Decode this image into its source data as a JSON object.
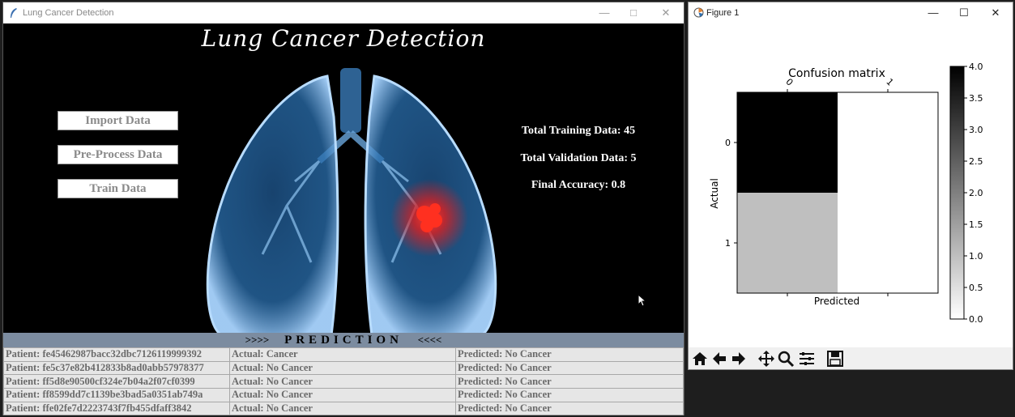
{
  "left_window": {
    "title": "Lung Cancer Detection",
    "controls": {
      "minimize": "—",
      "maximize": "□",
      "close": "✕"
    }
  },
  "app": {
    "heading": "Lung Cancer Detection",
    "buttons": {
      "import": "Import Data",
      "preprocess": "Pre-Process Data",
      "train": "Train Data"
    },
    "stats": {
      "training": "Total Training Data: 45",
      "validation": "Total Validation Data: 5",
      "accuracy": "Final Accuracy: 0.8"
    },
    "prediction": {
      "arrows_left": ">>>>",
      "label": "PREDICTION",
      "arrows_right": "<<<<",
      "rows": [
        {
          "patient": "Patient: fe45462987bacc32dbc7126119999392",
          "actual": "Actual: Cancer",
          "predicted": "Predicted: No Cancer"
        },
        {
          "patient": "Patient: fe5c37e82b412833b8ad0abb57978377",
          "actual": "Actual: No Cancer",
          "predicted": "Predicted: No Cancer"
        },
        {
          "patient": "Patient: ff5d8e90500cf324e7b04a2f07cf0399",
          "actual": "Actual: No Cancer",
          "predicted": "Predicted: No Cancer"
        },
        {
          "patient": "Patient: ff8599dd7c1139be3bad5a0351ab749a",
          "actual": "Actual: No Cancer",
          "predicted": "Predicted: No Cancer"
        },
        {
          "patient": "Patient: ffe02fe7d2223743f7fb455dfaff3842",
          "actual": "Actual: No Cancer",
          "predicted": "Predicted: No Cancer"
        }
      ]
    }
  },
  "right_window": {
    "title": "Figure 1",
    "controls": {
      "minimize": "—",
      "maximize": "☐",
      "close": "✕"
    },
    "toolbar": [
      "home-icon",
      "back-icon",
      "forward-icon",
      "pan-icon",
      "zoom-icon",
      "configure-icon",
      "save-icon"
    ]
  },
  "chart_data": {
    "type": "heatmap",
    "title": "Confusion matrix",
    "xlabel": "Predicted",
    "ylabel": "Actual",
    "x_tick_labels": [
      "0",
      "1"
    ],
    "y_tick_labels": [
      "0",
      "1"
    ],
    "matrix": [
      [
        4,
        0
      ],
      [
        1,
        0
      ]
    ],
    "colormap": "gray_r",
    "colorbar": {
      "min": 0.0,
      "max": 4.0,
      "ticks": [
        "0.0",
        "0.5",
        "1.0",
        "1.5",
        "2.0",
        "2.5",
        "3.0",
        "3.5",
        "4.0"
      ]
    }
  }
}
